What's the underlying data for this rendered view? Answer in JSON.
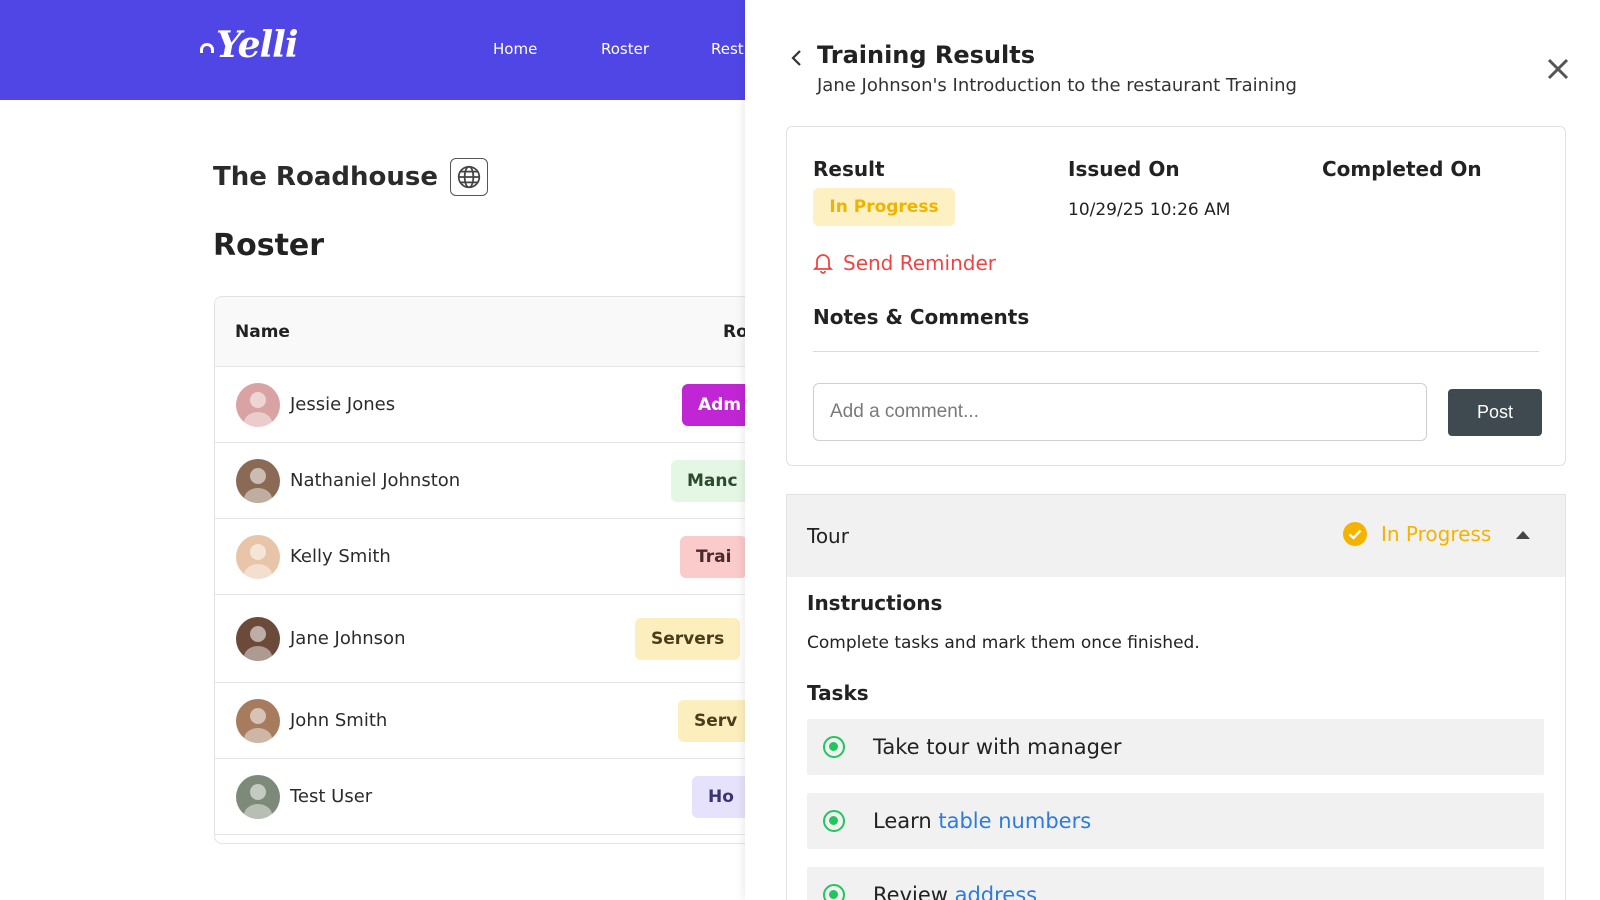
{
  "app": {
    "logo": "Yelli",
    "nav": {
      "home": "Home",
      "roster": "Roster",
      "rest": "Rest"
    },
    "venue": "The Roadhouse",
    "page_title": "Roster"
  },
  "roster_table": {
    "headers": {
      "name": "Name",
      "role": "Ro"
    },
    "rows": [
      {
        "name": "Jessie Jones",
        "role": "Adm",
        "role_bg": "#c026d3",
        "role_fg": "#ffffff",
        "avatar_bg": "#d9a3a3"
      },
      {
        "name": "Nathaniel Johnston",
        "role": "Manc",
        "role_bg": "#e4f7e4",
        "role_fg": "#2e4a2e",
        "avatar_bg": "#8a6a55"
      },
      {
        "name": "Kelly Smith",
        "role": "Trai",
        "role_bg": "#fbcaca",
        "role_fg": "#4a2a2a",
        "avatar_bg": "#e8c5a8"
      },
      {
        "name": "Jane Johnson",
        "role": "Servers",
        "role_bg": "#fcefbd",
        "role_fg": "#4a3d1a",
        "avatar_bg": "#6b4a3a"
      },
      {
        "name": "John Smith",
        "role": "Serv",
        "role_bg": "#fcefbd",
        "role_fg": "#4a3d1a",
        "avatar_bg": "#a77b5e"
      },
      {
        "name": "Test User",
        "role": "Ho",
        "role_bg": "#e6e2fb",
        "role_fg": "#3a3470",
        "avatar_bg": "#7d8a79"
      }
    ]
  },
  "drawer": {
    "title": "Training Results",
    "subtitle": "Jane Johnson's Introduction to the restaurant Training",
    "result_label": "Result",
    "result_value": "In Progress",
    "issued_label": "Issued On",
    "issued_value": "10/29/25 10:26 AM",
    "completed_label": "Completed On",
    "reminder": "Send Reminder",
    "notes_title": "Notes & Comments",
    "comment_placeholder": "Add a comment...",
    "post_label": "Post"
  },
  "section": {
    "name": "Tour",
    "status": "In Progress",
    "instructions_title": "Instructions",
    "instructions_text": "Complete tasks and mark them once finished.",
    "tasks_title": "Tasks",
    "tasks": [
      {
        "prefix": "Take tour with manager",
        "link": ""
      },
      {
        "prefix": "Learn ",
        "link": "table numbers"
      },
      {
        "prefix": "Review ",
        "link": "address"
      }
    ]
  },
  "colors": {
    "brand": "#4f46e5",
    "warning": "#f5b301",
    "danger": "#ef4444",
    "success": "#22c55e",
    "link": "#2b7be0"
  }
}
